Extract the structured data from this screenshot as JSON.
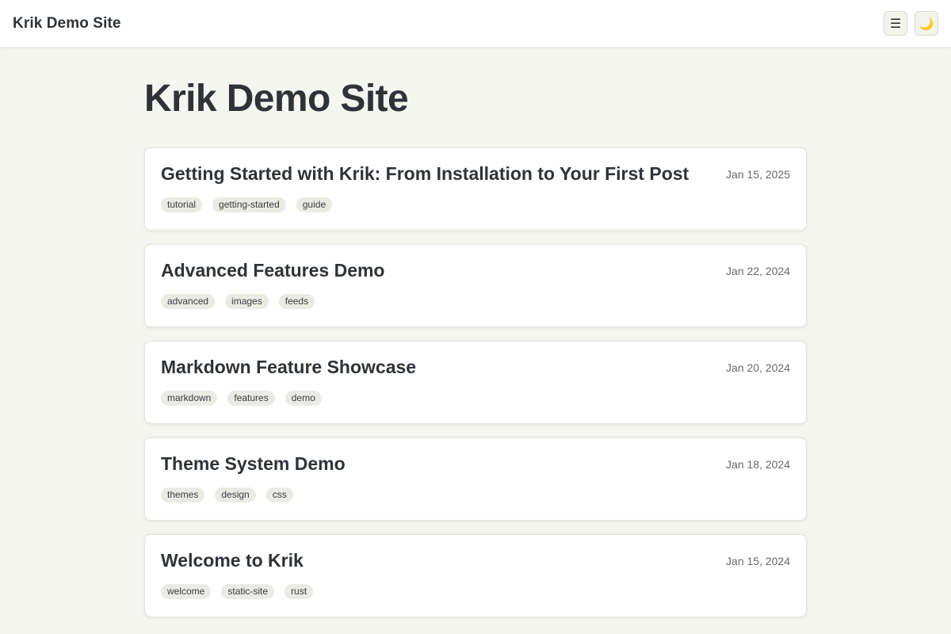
{
  "header": {
    "site_name": "Krik Demo Site",
    "menu_icon": "menu-icon",
    "theme_icon": "moon-icon"
  },
  "main": {
    "title": "Krik Demo Site",
    "posts": [
      {
        "title": "Getting Started with Krik: From Installation to Your First Post",
        "date": "Jan 15, 2025",
        "tags": [
          "tutorial",
          "getting-started",
          "guide"
        ]
      },
      {
        "title": "Advanced Features Demo",
        "date": "Jan 22, 2024",
        "tags": [
          "advanced",
          "images",
          "feeds"
        ]
      },
      {
        "title": "Markdown Feature Showcase",
        "date": "Jan 20, 2024",
        "tags": [
          "markdown",
          "features",
          "demo"
        ]
      },
      {
        "title": "Theme System Demo",
        "date": "Jan 18, 2024",
        "tags": [
          "themes",
          "design",
          "css"
        ]
      },
      {
        "title": "Welcome to Krik",
        "date": "Jan 15, 2024",
        "tags": [
          "welcome",
          "static-site",
          "rust"
        ]
      }
    ]
  }
}
